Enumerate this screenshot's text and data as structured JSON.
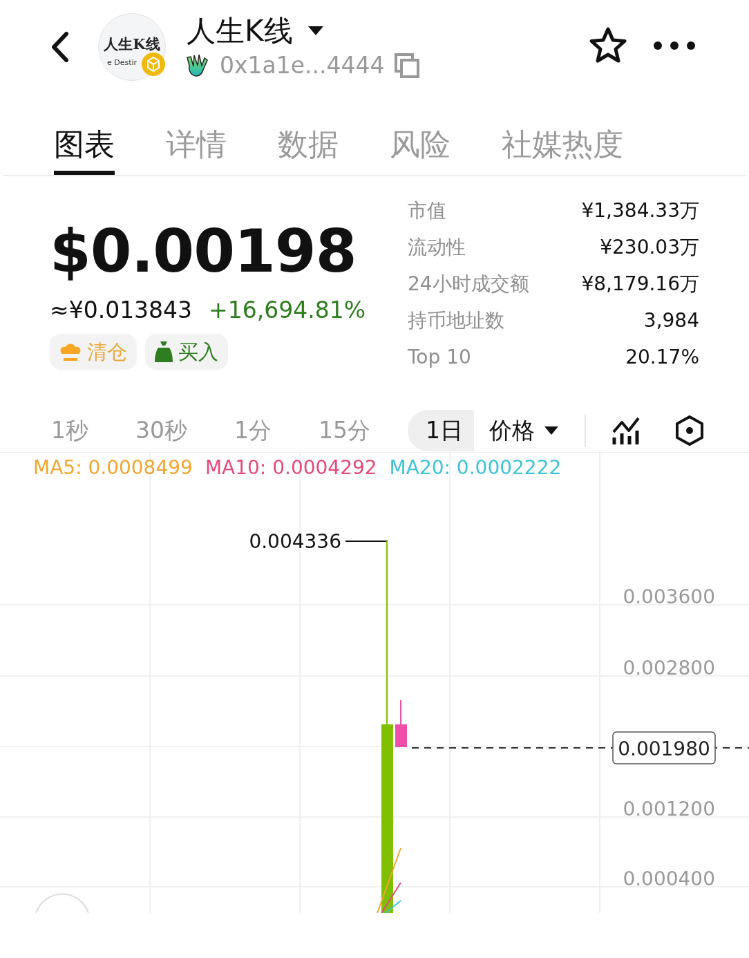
{
  "header": {
    "avatar_text": "人生K线",
    "avatar_subtext": "e Destir",
    "title": "人生K线",
    "address": "0x1a1e...4444"
  },
  "tabs": [
    {
      "label": "图表",
      "selected": true
    },
    {
      "label": "详情",
      "selected": false
    },
    {
      "label": "数据",
      "selected": false
    },
    {
      "label": "风险",
      "selected": false
    },
    {
      "label": "社媒热度",
      "selected": false
    }
  ],
  "price": {
    "usd": "$0.00198",
    "cny": "≈¥0.013843",
    "change": "+16,694.81%"
  },
  "actions": [
    {
      "kind": "sell",
      "label": "清仓"
    },
    {
      "kind": "buy",
      "label": "买入"
    }
  ],
  "stats": [
    {
      "label": "市值",
      "value": "¥1,384.33万"
    },
    {
      "label": "流动性",
      "value": "¥230.03万"
    },
    {
      "label": "24小时成交额",
      "value": "¥8,179.16万"
    },
    {
      "label": "持币地址数",
      "value": "3,984"
    },
    {
      "label": "Top 10",
      "value": "20.17%"
    }
  ],
  "intervals": [
    {
      "label": "1秒",
      "selected": false
    },
    {
      "label": "30秒",
      "selected": false
    },
    {
      "label": "1分",
      "selected": false
    },
    {
      "label": "15分",
      "selected": false
    },
    {
      "label": "1日",
      "selected": true
    }
  ],
  "price_mode": "价格",
  "ma": [
    {
      "label": "MA5: 0.0008499",
      "color": "#f0a632"
    },
    {
      "label": "MA10: 0.0004292",
      "color": "#e4497f"
    },
    {
      "label": "MA20: 0.0002222",
      "color": "#3dc3d3"
    }
  ],
  "chart": {
    "high_label": "0.004336",
    "y_labels": [
      "0.003600",
      "0.002800",
      "0.001200",
      "0.000400"
    ],
    "current_price": "0.001980"
  }
}
